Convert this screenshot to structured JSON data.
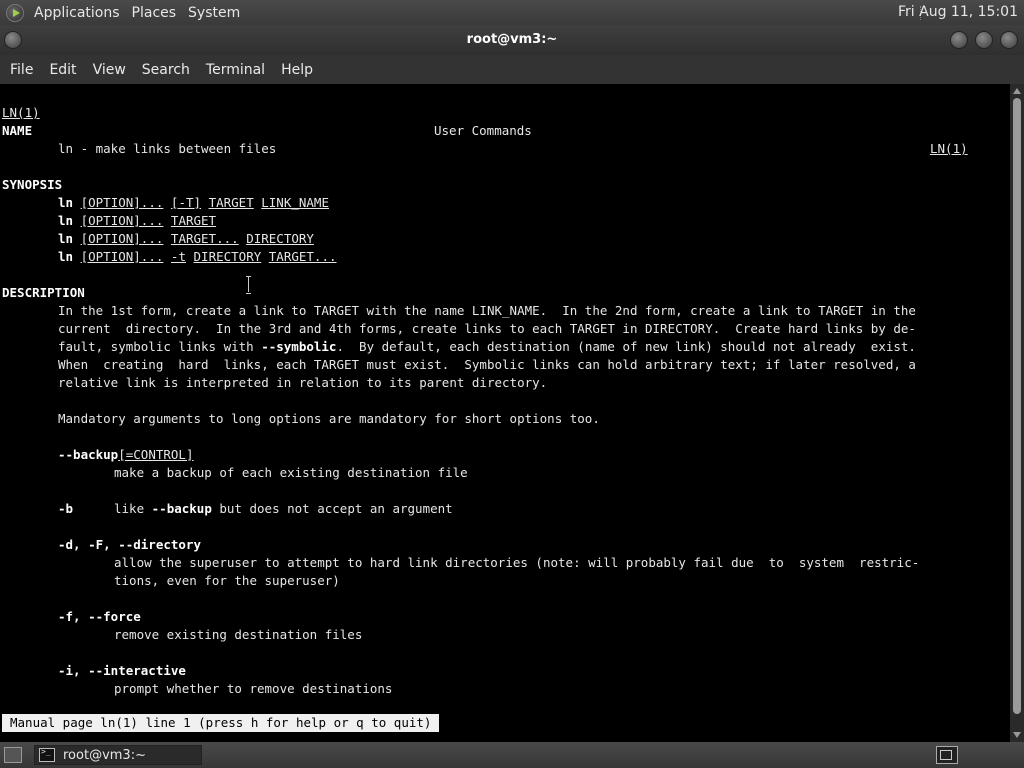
{
  "top_panel": {
    "menus": [
      "Applications",
      "Places",
      "System"
    ],
    "clock": "Fri Aug 11, 15:01"
  },
  "window": {
    "title": "root@vm3:~"
  },
  "menubar": {
    "items": [
      "File",
      "Edit",
      "View",
      "Search",
      "Terminal",
      "Help"
    ]
  },
  "terminal": {
    "header_left": "LN(1)",
    "header_center": "User Commands",
    "header_right": "LN(1)",
    "name_heading": "NAME",
    "name_text": "ln - make links between files",
    "synopsis_heading": "SYNOPSIS",
    "synopsis": [
      [
        "ln",
        "[OPTION]...",
        "[-T]",
        "TARGET",
        "LINK_NAME"
      ],
      [
        "ln",
        "[OPTION]...",
        "TARGET"
      ],
      [
        "ln",
        "[OPTION]...",
        "TARGET...",
        "DIRECTORY"
      ],
      [
        "ln",
        "[OPTION]...",
        "-t",
        "DIRECTORY",
        "TARGET..."
      ]
    ],
    "description_heading": "DESCRIPTION",
    "description_lines": [
      "In the 1st form, create a link to TARGET with the name LINK_NAME.  In the 2nd form, create a link to TARGET in the",
      "current  directory.  In the 3rd and 4th forms, create links to each TARGET in DIRECTORY.  Create hard links by de-",
      "fault, symbolic links with ",
      "When  creating  hard  links, each TARGET must exist.  Symbolic links can hold arbitrary text; if later resolved, a",
      "relative link is interpreted in relation to its parent directory."
    ],
    "symbolic_word": "--symbolic",
    "desc_line3_tail": ".  By default, each destination (name of new link) should not already  exist.",
    "mandatory_line": "Mandatory arguments to long options are mandatory for short options too.",
    "options": {
      "backup_flag": "--backup",
      "backup_arg": "[=CONTROL]",
      "backup_desc": "make a backup of each existing destination file",
      "b_flag": "-b",
      "b_desc_pre": "like ",
      "b_desc_flag": "--backup",
      "b_desc_post": " but does not accept an argument",
      "d_flag": "-d, -F, --directory",
      "d_desc_1": "allow the superuser to attempt to hard link directories (note: will probably fail due  to  system  restric-",
      "d_desc_2": "tions, even for the superuser)",
      "f_flag": "-f, --force",
      "f_desc": "remove existing destination files",
      "i_flag": "-i, --interactive",
      "i_desc": "prompt whether to remove destinations"
    },
    "status": "Manual page ln(1) line 1 (press h for help or q to quit)"
  },
  "bottom_panel": {
    "task_label": "root@vm3:~"
  }
}
